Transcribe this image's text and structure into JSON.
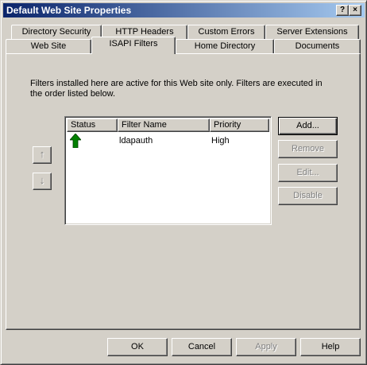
{
  "window": {
    "title": "Default Web Site Properties",
    "help_glyph": "?",
    "close_glyph": "×"
  },
  "tabs": {
    "row_back": [
      "Directory Security",
      "HTTP Headers",
      "Custom Errors",
      "Server Extensions"
    ],
    "row_front": [
      "Web Site",
      "ISAPI Filters",
      "Home Directory",
      "Documents"
    ],
    "selected": "ISAPI Filters"
  },
  "isapi": {
    "description": "Filters installed here are active for this Web site only. Filters are executed in the order listed below.",
    "columns": [
      "Status",
      "Filter Name",
      "Priority"
    ],
    "rows": [
      {
        "status_icon": "green-up-arrow-icon",
        "filter_name": "ldapauth",
        "priority": "High"
      }
    ],
    "move_up_glyph": "↑",
    "move_down_glyph": "↓",
    "buttons": {
      "add": "Add...",
      "remove": "Remove",
      "edit": "Edit...",
      "disable": "Disable"
    }
  },
  "footer": {
    "ok": "OK",
    "cancel": "Cancel",
    "apply": "Apply",
    "help": "Help"
  },
  "colors": {
    "titlebar_start": "#0a246a",
    "titlebar_end": "#a6caf0",
    "status_arrow": "#008000",
    "face": "#d4d0c8"
  }
}
